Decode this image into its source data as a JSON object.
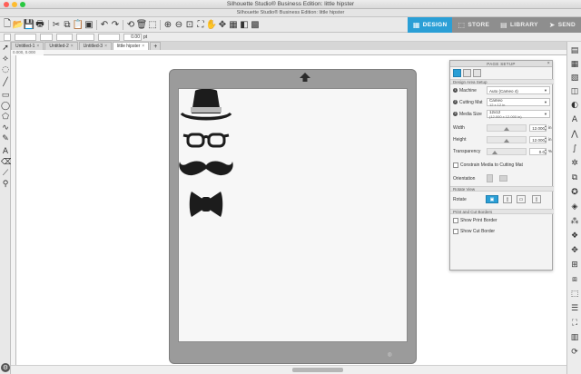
{
  "window": {
    "title": "Silhouette Studio® Business Edition: little hipster",
    "subtitle": "Silhouette Studio® Business Edition: little hipster"
  },
  "nav": {
    "design": "DESIGN",
    "store": "STORE",
    "library": "LIBRARY",
    "send": "SEND",
    "active_color": "#2a9fd6"
  },
  "style_bar": {
    "line_width": "0.00",
    "unit": "pt"
  },
  "doc_tabs": [
    "Untitled-1",
    "Untitled-2",
    "Untitled-3",
    "little hipster"
  ],
  "coords": "0.000, 0.000",
  "panel": {
    "title": "PAGE SETUP",
    "design_area_setup": "Design Area Setup",
    "machine_label": "Machine",
    "machine_value": "Auto (Cameo 4)",
    "cutting_mat_label": "Cutting Mat",
    "cutting_mat_value": "Cameo",
    "cutting_mat_size": "12 x 12 in",
    "media_size_label": "Media Size",
    "media_size_value": "12x12",
    "media_size_dims": "(12.000 x 12.000 in)",
    "width_label": "Width",
    "width_value": "12.000",
    "height_label": "Height",
    "height_value": "12.000",
    "unit_in": "in",
    "transparency_label": "Transparency",
    "transparency_value": "0.0",
    "unit_pct": "%",
    "transparency_level": 0.08,
    "constrain_label": "Constrain Media to Cutting Mat",
    "orientation_label": "Orientation",
    "rotate_view_section": "Rotate View",
    "rotate_label": "Rotate",
    "print_cut_section": "Print and Cut Borders",
    "show_print_border": "Show Print Border",
    "show_cut_border": "Show Cut Border"
  },
  "design": {
    "hat_icon": "fedora-hat",
    "glasses_icon": "eyeglasses",
    "mustache_icon": "mustache",
    "bowtie_icon": "bow-tie"
  }
}
